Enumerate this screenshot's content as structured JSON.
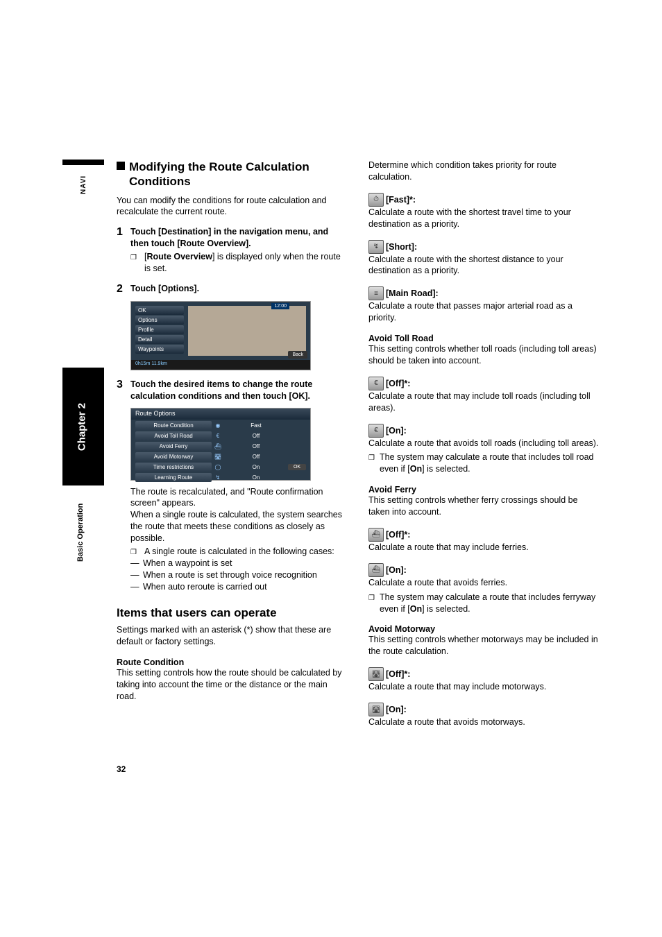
{
  "sidebar": {
    "navi": "NAVI",
    "chapter": "Chapter 2",
    "basic_operation": "Basic Operation"
  },
  "left": {
    "heading": "Modifying the Route Calculation Conditions",
    "intro": "You can modify the conditions for route calculation and recalculate the current route.",
    "step1": "Touch [Destination] in the navigation menu, and then touch [Route Overview].",
    "step1_note_a": "[",
    "step1_note_bold": "Route Overview",
    "step1_note_b": "] is displayed only when the route is set.",
    "step2": "Touch [Options].",
    "ss1_menu": [
      "OK",
      "Options",
      "Profile",
      "Detail",
      "Waypoints"
    ],
    "ss1_time": "12:00",
    "ss1_bottom": "0h15m 11.9km",
    "ss1_back": "Back",
    "step3": "Touch the desired items to change the route calculation conditions and then touch [OK].",
    "ss2_title": "Route Options",
    "ss2_rows": [
      {
        "label": "Route Condition",
        "icon": "◉",
        "val": "Fast"
      },
      {
        "label": "Avoid Toll Road",
        "icon": "€",
        "val": "Off"
      },
      {
        "label": "Avoid Ferry",
        "icon": "⛴",
        "val": "Off"
      },
      {
        "label": "Avoid Motorway",
        "icon": "🛣",
        "val": "Off"
      },
      {
        "label": "Time restrictions",
        "icon": "◯",
        "val": "On"
      },
      {
        "label": "Learning Route",
        "icon": "↯",
        "val": "On"
      }
    ],
    "ss2_ok": "OK",
    "recalc_a": "The route is recalculated, and \"Route confirmation screen\" appears.",
    "recalc_b": "When a single route is calculated, the system searches the route that meets these conditions as closely as possible.",
    "single_intro": "A single route is calculated in the following cases:",
    "dash1": "When a waypoint is set",
    "dash2": "When a route is set through voice recognition",
    "dash3": "When auto reroute is carried out",
    "items_heading": "Items that users can operate",
    "items_body": "Settings marked with an asterisk (*) show that these are default or factory settings.",
    "route_cond_title": "Route Condition",
    "route_cond_body": "This setting controls how the route should be calculated by taking into account the time or the distance or the main road."
  },
  "right": {
    "determine": "Determine which condition takes priority for route calculation.",
    "fast_label": "[Fast]*:",
    "fast_desc": "Calculate a route with the shortest travel time to your destination as a priority.",
    "short_label": "[Short]:",
    "short_desc": "Calculate a route with the shortest distance to your destination as a priority.",
    "main_label": "[Main Road]:",
    "main_desc": "Calculate a route that passes major arterial road as a priority.",
    "toll_title": "Avoid Toll Road",
    "toll_body": "This setting controls whether toll roads (including toll areas) should be taken into account.",
    "toll_off_label": "[Off]*:",
    "toll_off_desc": "Calculate a route that may include toll roads (including toll areas).",
    "toll_on_label": "[On]:",
    "toll_on_desc": "Calculate a route that avoids toll roads (including toll areas).",
    "toll_note_a": "The system may calculate a route that includes toll road even if [",
    "toll_note_bold": "On",
    "toll_note_b": "] is selected.",
    "ferry_title": "Avoid Ferry",
    "ferry_body": "This setting controls whether ferry crossings should be taken into account.",
    "ferry_off_label": "[Off]*:",
    "ferry_off_desc": "Calculate a route that may include ferries.",
    "ferry_on_label": "[On]:",
    "ferry_on_desc": "Calculate a route that avoids ferries.",
    "ferry_note_a": "The system may calculate a route that includes ferryway even if [",
    "ferry_note_bold": "On",
    "ferry_note_b": "] is selected.",
    "motor_title": "Avoid Motorway",
    "motor_body": "This setting controls whether motorways may be included in the route calculation.",
    "motor_off_label": "[Off]*:",
    "motor_off_desc": "Calculate a route that may include motorways.",
    "motor_on_label": "[On]:",
    "motor_on_desc": "Calculate a route that avoids motorways."
  },
  "page_number": "32"
}
